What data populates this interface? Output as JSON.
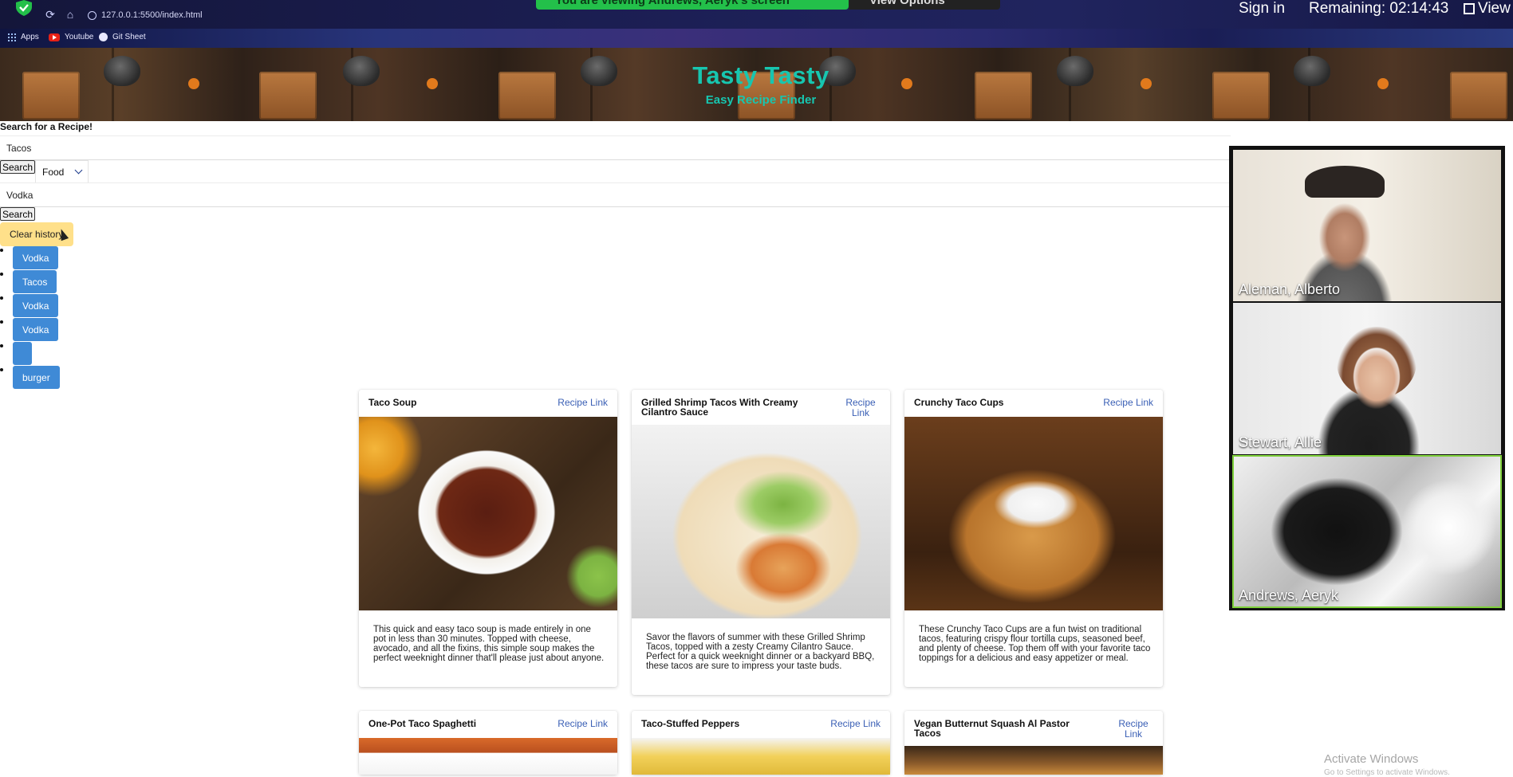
{
  "browser": {
    "url": "127.0.0.1:5500/index.html",
    "bookmarks": [
      "Apps",
      "Youtube",
      "Git Sheet"
    ]
  },
  "zoom_bar": {
    "share_text": "You are viewing Andrews, Aeryk's screen",
    "options_label": "View Options",
    "sign_in": "Sign in",
    "remaining": "Remaining: 02:14:43",
    "view": "View"
  },
  "site": {
    "title": "Tasty Tasty",
    "subtitle": "Easy Recipe Finder"
  },
  "search": {
    "heading": "Search for a Recipe!",
    "food_query": "Tacos",
    "search_label": "Search",
    "category": "Food",
    "drink_query": "Vodka",
    "search_label_2": "Search",
    "clear_label": "Clear history"
  },
  "history": [
    "Vodka",
    "Tacos",
    "Vodka",
    "Vodka",
    "",
    "burger"
  ],
  "recipes": [
    {
      "title": "Taco Soup",
      "link": "Recipe Link",
      "description": "This quick and easy taco soup is made entirely in one pot in less than 30 minutes. Topped with cheese, avocado, and all the fixins, this simple soup makes the perfect weeknight dinner that'll please just about anyone."
    },
    {
      "title": "Grilled Shrimp Tacos With Creamy Cilantro Sauce",
      "link": "Recipe Link",
      "description": "Savor the flavors of summer with these Grilled Shrimp Tacos, topped with a zesty Creamy Cilantro Sauce. Perfect for a quick weeknight dinner or a backyard BBQ, these tacos are sure to impress your taste buds."
    },
    {
      "title": "Crunchy Taco Cups",
      "link": "Recipe Link",
      "description": "These Crunchy Taco Cups are a fun twist on traditional tacos, featuring crispy flour tortilla cups, seasoned beef, and plenty of cheese. Top them off with your favorite taco toppings for a delicious and easy appetizer or meal."
    },
    {
      "title": "One-Pot Taco Spaghetti",
      "link": "Recipe Link"
    },
    {
      "title": "Taco-Stuffed Peppers",
      "link": "Recipe Link"
    },
    {
      "title": "Vegan Butternut Squash Al Pastor Tacos",
      "link": "Recipe Link"
    }
  ],
  "participants": [
    "Aleman, Alberto",
    "Stewart, Allie",
    "Andrews, Aeryk"
  ],
  "windows": {
    "activate": "Activate Windows",
    "activate_hint": "Go to Settings to activate Windows."
  },
  "colors": {
    "title_teal": "#17c6b0",
    "history_button": "#3f8ad6",
    "clear_button": "#ffe08a",
    "link_blue": "#3a5fb5",
    "share_green": "#23c04a"
  }
}
